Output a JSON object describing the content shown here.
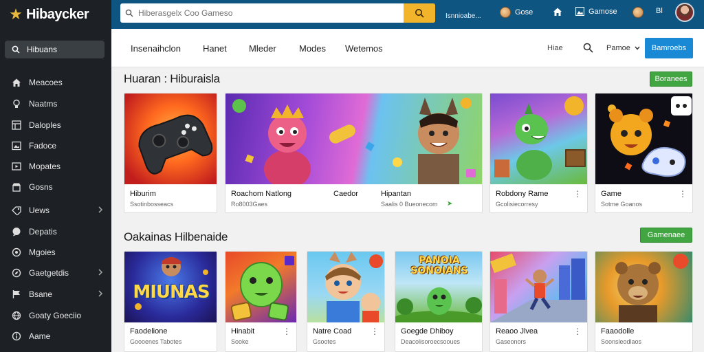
{
  "header": {
    "logo_text": "Hibaycker",
    "search_placeholder": "Hiberasgelx Coo Gameso",
    "link_text": "Isnnioabe...",
    "item1_label": "Gose",
    "item2_label": "Gamose",
    "item3_label": "Bl"
  },
  "sidebar": {
    "search_label": "Hibuans",
    "items": [
      {
        "label": "Meacoes",
        "icon": "home-icon"
      },
      {
        "label": "Naatms",
        "icon": "bulb-icon"
      },
      {
        "label": "Daloples",
        "icon": "grid-icon"
      },
      {
        "label": "Fadoce",
        "icon": "image-icon"
      },
      {
        "label": "Mopates",
        "icon": "film-icon"
      },
      {
        "label": "Gosns",
        "icon": "store-icon"
      },
      {
        "label": "Uews",
        "icon": "tag-icon"
      },
      {
        "label": "Depatis",
        "icon": "chat-icon"
      },
      {
        "label": "Mgoies",
        "icon": "circle-icon"
      },
      {
        "label": "Gaetgetdis",
        "icon": "compass-icon"
      },
      {
        "label": "Bsane",
        "icon": "flag-icon"
      },
      {
        "label": "Goaty Goeciio",
        "icon": "globe-icon"
      },
      {
        "label": "Aame",
        "icon": "info-icon"
      }
    ]
  },
  "nav": {
    "tabs": [
      "Insenaihclon",
      "Hanet",
      "Mleder",
      "Modes",
      "Wetemos"
    ],
    "link": "Hiae",
    "select_label": "Pamoe",
    "button_label": "Bamroebs"
  },
  "section1": {
    "title": "Huaran : Hiburaisla",
    "button_label": "Boranees",
    "cards": [
      {
        "title": "Hiburim",
        "sub": "Ssotinbosseacs"
      },
      {
        "title": "Roachom Natlong",
        "sub": "Ro8003Gaes",
        "aux": "Caedor"
      },
      {
        "title": "Hipantan",
        "sub": "Saalis 0 Bueonecom"
      },
      {
        "title": "Robdony Rame",
        "sub": "Gcolisiecorresy"
      },
      {
        "title": "Game",
        "sub": "Sotme Goanos"
      }
    ]
  },
  "section2": {
    "title": "Oakainas Hilbenaide",
    "button_label": "Gamenaee",
    "cards": [
      {
        "title": "Faodelione",
        "sub": "Goooenes Tabotes",
        "art": "MIUNAS"
      },
      {
        "title": "Hinabit",
        "sub": "Sooke"
      },
      {
        "title": "Natre Coad",
        "sub": "Gsootes"
      },
      {
        "title": "Goegde Dhiboy",
        "sub": "Deacolisoroecsooues",
        "art": "PANOIA SONOIANS"
      },
      {
        "title": "Reaoo Jlvea",
        "sub": "Gaseonors"
      },
      {
        "title": "Faaodolle",
        "sub": "Soonsleodlaos"
      }
    ]
  }
}
